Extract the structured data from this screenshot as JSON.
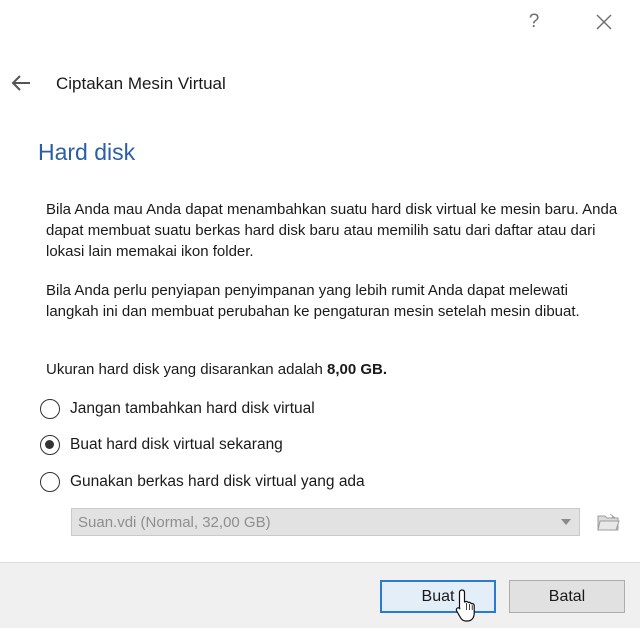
{
  "titlebar": {
    "help_label": "?",
    "close_icon": "close-icon"
  },
  "header": {
    "back_icon": "arrow-left-icon",
    "title": "Ciptakan Mesin Virtual"
  },
  "page": {
    "title": "Hard disk",
    "paragraph1": "Bila Anda mau Anda dapat menambahkan suatu hard disk virtual ke mesin baru. Anda dapat membuat suatu berkas hard disk baru atau memilih satu dari daftar atau dari lokasi lain memakai ikon folder.",
    "paragraph2": "Bila Anda perlu penyiapan penyimpanan yang lebih rumit Anda dapat melewati langkah ini dan membuat perubahan ke pengaturan mesin setelah mesin dibuat.",
    "recommended_prefix": "Ukuran hard disk yang disarankan adalah ",
    "recommended_size": "8,00 GB",
    "recommended_suffix": "."
  },
  "options": [
    {
      "label": "Jangan tambahkan hard disk virtual",
      "checked": false
    },
    {
      "label": "Buat hard disk virtual sekarang",
      "checked": true
    },
    {
      "label": "Gunakan berkas hard disk virtual yang ada",
      "checked": false
    }
  ],
  "disk_select": {
    "value": "Suan.vdi (Normal, 32,00 GB)",
    "enabled": false,
    "folder_icon": "folder-icon"
  },
  "buttons": {
    "create": "Buat",
    "cancel": "Batal"
  },
  "colors": {
    "title_blue": "#2a5fa5",
    "default_button_border": "#2a79d2"
  }
}
